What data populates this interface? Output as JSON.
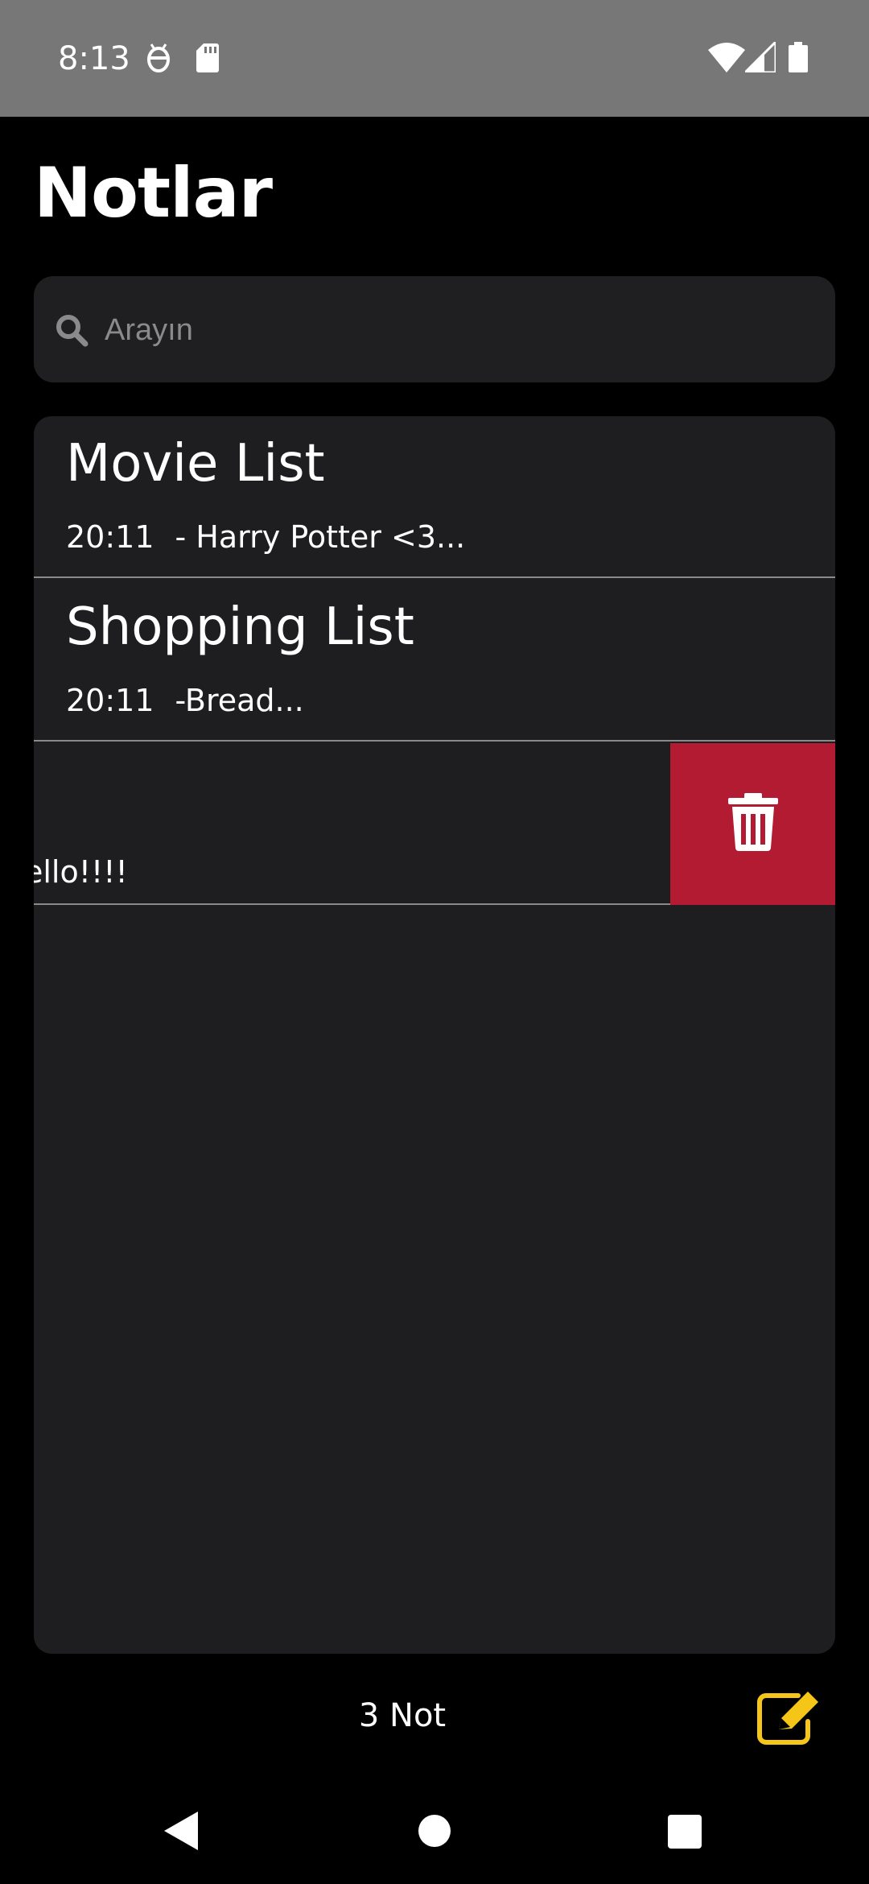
{
  "status_bar": {
    "time": "8:13",
    "icons": [
      "android-debug-icon",
      "sd-card-icon",
      "wifi-icon",
      "signal-icon",
      "battery-icon"
    ]
  },
  "header": {
    "title": "Notlar"
  },
  "search": {
    "placeholder": "Arayın",
    "value": "",
    "icon": "search-icon"
  },
  "notes": [
    {
      "title": "Movie List",
      "time": "20:11",
      "preview": "- Harry Potter <3..."
    },
    {
      "title": "Shopping List",
      "time": "20:11",
      "preview": "-Bread..."
    }
  ],
  "swiped_note": {
    "preview_fragment": "ello!!!!",
    "delete_icon": "trash-icon"
  },
  "footer": {
    "count_label": "3 Not",
    "compose_icon": "compose-icon"
  },
  "nav": {
    "back": "back-icon",
    "home": "home-icon",
    "recents": "recents-icon"
  },
  "colors": {
    "accent": "#f5c518",
    "delete": "#b21b32",
    "panel": "#1e1e20"
  }
}
